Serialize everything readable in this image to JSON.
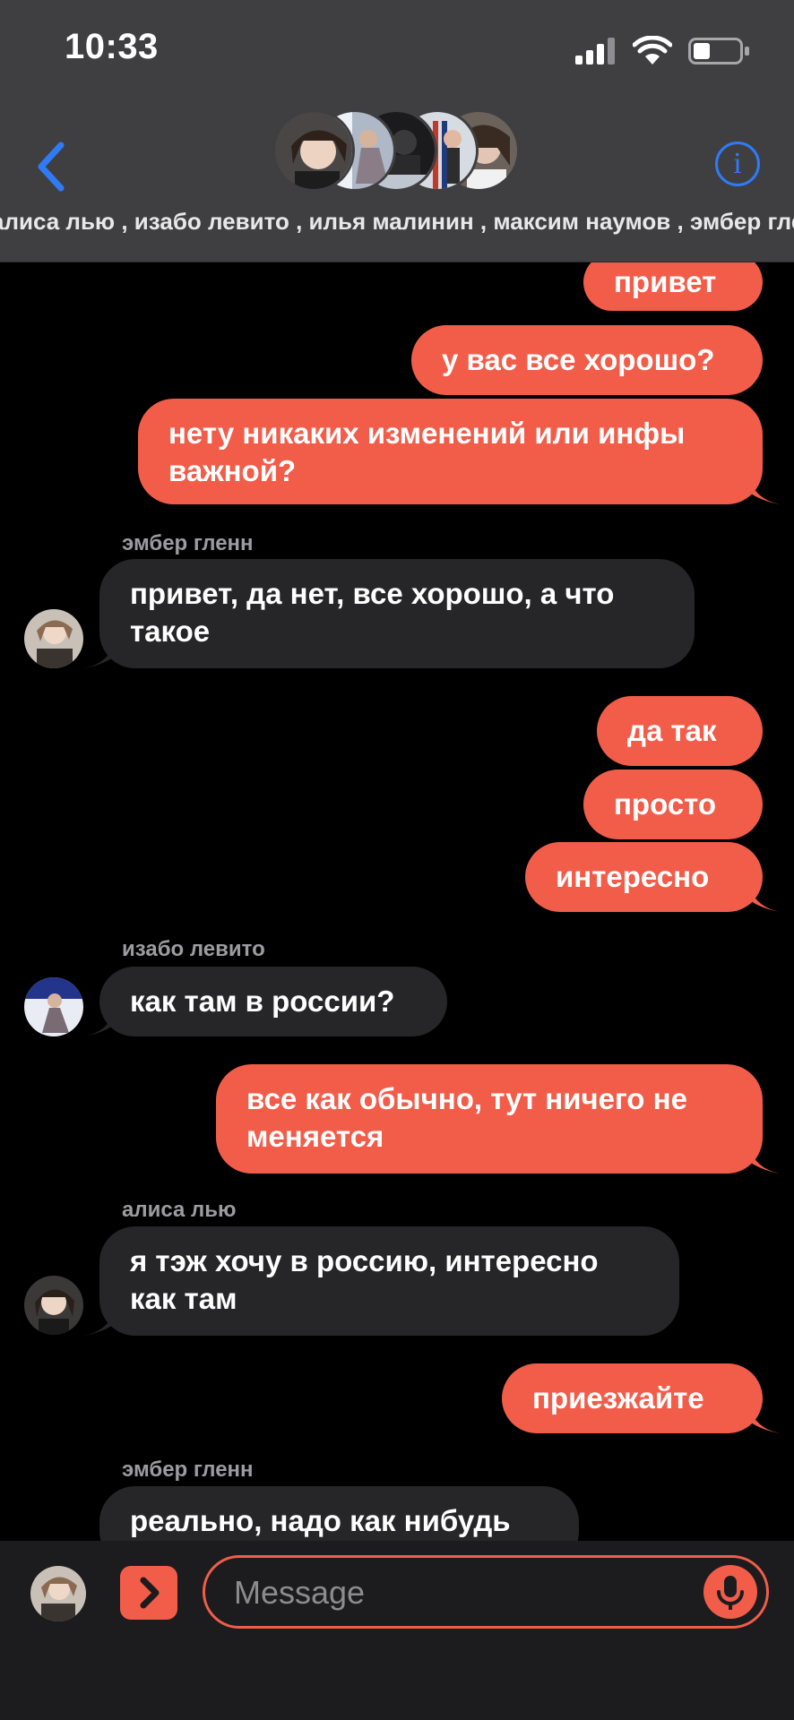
{
  "status_bar": {
    "time": "10:33"
  },
  "header": {
    "participants": "алиса лью , изабо левито , илья малинин , максим наумов , эмбер гленн",
    "info_label": "i"
  },
  "colors": {
    "accent": "#f25d4a",
    "incoming_bubble": "#262628",
    "header_bg": "#3f3f41",
    "ios_blue": "#2f7bf5"
  },
  "messages": [
    {
      "direction": "out",
      "text": "привет"
    },
    {
      "direction": "out",
      "text": "у вас все хорошо?"
    },
    {
      "direction": "out",
      "text": "нету никаких изменений или инфы\nважной?"
    },
    {
      "direction": "in",
      "sender": "эмбер гленн",
      "text": "привет, да нет, все хорошо, а что\nтакое"
    },
    {
      "direction": "out",
      "text": "да так"
    },
    {
      "direction": "out",
      "text": "просто"
    },
    {
      "direction": "out",
      "text": "интересно"
    },
    {
      "direction": "in",
      "sender": "изабо левито",
      "text": "как там в россии?"
    },
    {
      "direction": "out",
      "text": "все как обычно, тут ничего не\nменяется"
    },
    {
      "direction": "in",
      "sender": "алиса лью",
      "text": "я тэж хочу в россию, интересно\nкак там"
    },
    {
      "direction": "out",
      "text": "приезжайте"
    },
    {
      "direction": "in",
      "sender": "эмбер гленн",
      "text": "реально, надо как нибудь"
    }
  ],
  "composer": {
    "placeholder": "Message"
  }
}
